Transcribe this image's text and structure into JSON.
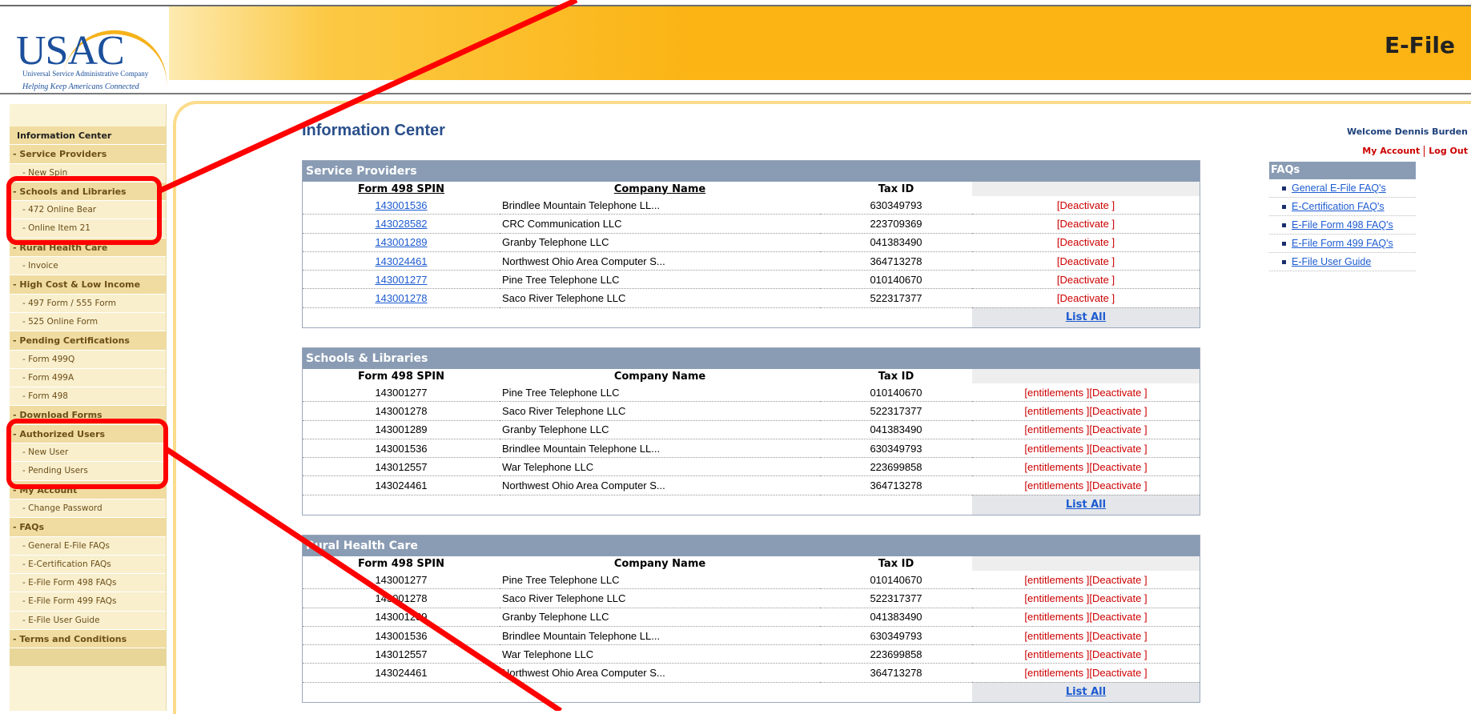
{
  "header": {
    "logo_text": "USAC",
    "logo_subtitle": "Universal Service Administrative Company",
    "logo_tagline": "Helping Keep Americans Connected",
    "app_title": "E-File"
  },
  "sidebar": {
    "title": "Information Center",
    "items": [
      {
        "label": "- Service Providers",
        "type": "section"
      },
      {
        "label": "- New Spin",
        "type": "sub"
      },
      {
        "label": "- Schools and Libraries",
        "type": "section"
      },
      {
        "label": "- 472 Online Bear",
        "type": "sub"
      },
      {
        "label": "- Online Item 21",
        "type": "sub"
      },
      {
        "label": "- Rural Health Care",
        "type": "section"
      },
      {
        "label": "- Invoice",
        "type": "sub"
      },
      {
        "label": "- High Cost & Low Income",
        "type": "section"
      },
      {
        "label": "- 497 Form / 555 Form",
        "type": "sub"
      },
      {
        "label": "- 525 Online Form",
        "type": "sub"
      },
      {
        "label": "- Pending Certifications",
        "type": "section"
      },
      {
        "label": "- Form 499Q",
        "type": "sub"
      },
      {
        "label": "- Form 499A",
        "type": "sub"
      },
      {
        "label": "- Form 498",
        "type": "sub"
      },
      {
        "label": "- Download Forms",
        "type": "section"
      },
      {
        "label": "- Authorized Users",
        "type": "section"
      },
      {
        "label": "- New User",
        "type": "sub"
      },
      {
        "label": "- Pending Users",
        "type": "sub"
      },
      {
        "label": "- My Account",
        "type": "section"
      },
      {
        "label": "- Change Password",
        "type": "sub"
      },
      {
        "label": "- FAQs",
        "type": "section"
      },
      {
        "label": "- General E-File FAQs",
        "type": "sub"
      },
      {
        "label": "- E-Certification FAQs",
        "type": "sub"
      },
      {
        "label": "- E-File Form 498 FAQs",
        "type": "sub"
      },
      {
        "label": "- E-File Form 499 FAQs",
        "type": "sub"
      },
      {
        "label": "- E-File User Guide",
        "type": "sub"
      },
      {
        "label": "- Terms and Conditions",
        "type": "section"
      }
    ]
  },
  "main": {
    "page_title": "Information Center",
    "welcome": "Welcome Dennis Burden",
    "my_account": "My Account",
    "log_out": "Log Out",
    "list_all": "List All",
    "columns": {
      "spin": "Form 498 SPIN",
      "company": "Company Name",
      "tax": "Tax ID"
    },
    "actions": {
      "deactivate": "[Deactivate ]",
      "entitlements": "[entitlements ]"
    },
    "panels": [
      {
        "title": "Service Providers",
        "linked": true,
        "rows": [
          {
            "spin": "143001536",
            "company": "Brindlee Mountain Telephone LL...",
            "tax": "630349793"
          },
          {
            "spin": "143028582",
            "company": "CRC Communication LLC",
            "tax": "223709369"
          },
          {
            "spin": "143001289",
            "company": "Granby Telephone LLC",
            "tax": "041383490"
          },
          {
            "spin": "143024461",
            "company": "Northwest Ohio Area Computer S...",
            "tax": "364713278"
          },
          {
            "spin": "143001277",
            "company": "Pine Tree Telephone LLC",
            "tax": "010140670"
          },
          {
            "spin": "143001278",
            "company": "Saco River Telephone LLC",
            "tax": "522317377"
          }
        ]
      },
      {
        "title": "Schools & Libraries",
        "linked": false,
        "rows": [
          {
            "spin": "143001277",
            "company": "Pine Tree Telephone LLC",
            "tax": "010140670"
          },
          {
            "spin": "143001278",
            "company": "Saco River Telephone LLC",
            "tax": "522317377"
          },
          {
            "spin": "143001289",
            "company": "Granby Telephone LLC",
            "tax": "041383490"
          },
          {
            "spin": "143001536",
            "company": "Brindlee Mountain Telephone LL...",
            "tax": "630349793"
          },
          {
            "spin": "143012557",
            "company": "War Telephone LLC",
            "tax": "223699858"
          },
          {
            "spin": "143024461",
            "company": "Northwest Ohio Area Computer S...",
            "tax": "364713278"
          }
        ]
      },
      {
        "title": "Rural Health Care",
        "linked": false,
        "rows": [
          {
            "spin": "143001277",
            "company": "Pine Tree Telephone LLC",
            "tax": "010140670"
          },
          {
            "spin": "143001278",
            "company": "Saco River Telephone LLC",
            "tax": "522317377"
          },
          {
            "spin": "143001289",
            "company": "Granby Telephone LLC",
            "tax": "041383490"
          },
          {
            "spin": "143001536",
            "company": "Brindlee Mountain Telephone LL...",
            "tax": "630349793"
          },
          {
            "spin": "143012557",
            "company": "War Telephone LLC",
            "tax": "223699858"
          },
          {
            "spin": "143024461",
            "company": "Northwest Ohio Area Computer S...",
            "tax": "364713278"
          }
        ]
      }
    ]
  },
  "faqs": {
    "title": "FAQs",
    "links": [
      "General E-File FAQ's",
      "E-Certification FAQ's",
      "E-File Form 498 FAQ's",
      "E-File Form 499 FAQ's",
      "E-File User Guide"
    ]
  },
  "annotation": {
    "color": "#ff0000"
  }
}
